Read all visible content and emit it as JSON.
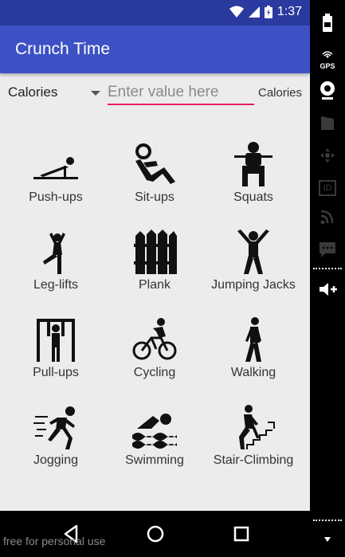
{
  "status_bar": {
    "time": "1:37"
  },
  "app_bar": {
    "title": "Crunch Time"
  },
  "input_row": {
    "spinner_value": "Calories",
    "input_placeholder": "Enter value here",
    "unit_label": "Calories"
  },
  "exercises": [
    {
      "label": "Push-ups",
      "icon": "push-up-icon"
    },
    {
      "label": "Sit-ups",
      "icon": "sit-up-icon"
    },
    {
      "label": "Squats",
      "icon": "squat-icon"
    },
    {
      "label": "Leg-lifts",
      "icon": "leg-lift-icon"
    },
    {
      "label": "Plank",
      "icon": "plank-icon"
    },
    {
      "label": "Jumping Jacks",
      "icon": "jumping-jacks-icon"
    },
    {
      "label": "Pull-ups",
      "icon": "pull-up-icon"
    },
    {
      "label": "Cycling",
      "icon": "cycling-icon"
    },
    {
      "label": "Walking",
      "icon": "walking-icon"
    },
    {
      "label": "Jogging",
      "icon": "jogging-icon"
    },
    {
      "label": "Swimming",
      "icon": "swimming-icon"
    },
    {
      "label": "Stair-Climbing",
      "icon": "stair-climbing-icon"
    }
  ],
  "watermark": "free for personal use",
  "emulator_panel": {
    "gps_label": "GPS",
    "id_label": "ID"
  },
  "colors": {
    "status_bar": "#2b3a9e",
    "app_bar": "#3d51c4",
    "accent": "#e91e63",
    "background": "#ececec"
  }
}
